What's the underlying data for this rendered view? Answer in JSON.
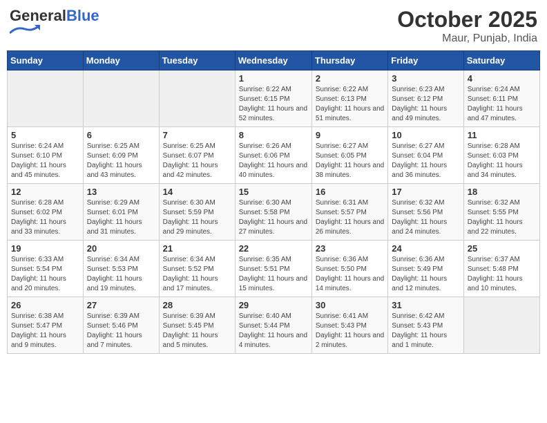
{
  "header": {
    "logo_general": "General",
    "logo_blue": "Blue",
    "title": "October 2025",
    "subtitle": "Maur, Punjab, India"
  },
  "days_of_week": [
    "Sunday",
    "Monday",
    "Tuesday",
    "Wednesday",
    "Thursday",
    "Friday",
    "Saturday"
  ],
  "weeks": [
    [
      {
        "day": "",
        "sunrise": "",
        "sunset": "",
        "daylight": ""
      },
      {
        "day": "",
        "sunrise": "",
        "sunset": "",
        "daylight": ""
      },
      {
        "day": "",
        "sunrise": "",
        "sunset": "",
        "daylight": ""
      },
      {
        "day": "1",
        "sunrise": "6:22 AM",
        "sunset": "6:15 PM",
        "daylight": "11 hours and 52 minutes."
      },
      {
        "day": "2",
        "sunrise": "6:22 AM",
        "sunset": "6:13 PM",
        "daylight": "11 hours and 51 minutes."
      },
      {
        "day": "3",
        "sunrise": "6:23 AM",
        "sunset": "6:12 PM",
        "daylight": "11 hours and 49 minutes."
      },
      {
        "day": "4",
        "sunrise": "6:24 AM",
        "sunset": "6:11 PM",
        "daylight": "11 hours and 47 minutes."
      }
    ],
    [
      {
        "day": "5",
        "sunrise": "6:24 AM",
        "sunset": "6:10 PM",
        "daylight": "11 hours and 45 minutes."
      },
      {
        "day": "6",
        "sunrise": "6:25 AM",
        "sunset": "6:09 PM",
        "daylight": "11 hours and 43 minutes."
      },
      {
        "day": "7",
        "sunrise": "6:25 AM",
        "sunset": "6:07 PM",
        "daylight": "11 hours and 42 minutes."
      },
      {
        "day": "8",
        "sunrise": "6:26 AM",
        "sunset": "6:06 PM",
        "daylight": "11 hours and 40 minutes."
      },
      {
        "day": "9",
        "sunrise": "6:27 AM",
        "sunset": "6:05 PM",
        "daylight": "11 hours and 38 minutes."
      },
      {
        "day": "10",
        "sunrise": "6:27 AM",
        "sunset": "6:04 PM",
        "daylight": "11 hours and 36 minutes."
      },
      {
        "day": "11",
        "sunrise": "6:28 AM",
        "sunset": "6:03 PM",
        "daylight": "11 hours and 34 minutes."
      }
    ],
    [
      {
        "day": "12",
        "sunrise": "6:28 AM",
        "sunset": "6:02 PM",
        "daylight": "11 hours and 33 minutes."
      },
      {
        "day": "13",
        "sunrise": "6:29 AM",
        "sunset": "6:01 PM",
        "daylight": "11 hours and 31 minutes."
      },
      {
        "day": "14",
        "sunrise": "6:30 AM",
        "sunset": "5:59 PM",
        "daylight": "11 hours and 29 minutes."
      },
      {
        "day": "15",
        "sunrise": "6:30 AM",
        "sunset": "5:58 PM",
        "daylight": "11 hours and 27 minutes."
      },
      {
        "day": "16",
        "sunrise": "6:31 AM",
        "sunset": "5:57 PM",
        "daylight": "11 hours and 26 minutes."
      },
      {
        "day": "17",
        "sunrise": "6:32 AM",
        "sunset": "5:56 PM",
        "daylight": "11 hours and 24 minutes."
      },
      {
        "day": "18",
        "sunrise": "6:32 AM",
        "sunset": "5:55 PM",
        "daylight": "11 hours and 22 minutes."
      }
    ],
    [
      {
        "day": "19",
        "sunrise": "6:33 AM",
        "sunset": "5:54 PM",
        "daylight": "11 hours and 20 minutes."
      },
      {
        "day": "20",
        "sunrise": "6:34 AM",
        "sunset": "5:53 PM",
        "daylight": "11 hours and 19 minutes."
      },
      {
        "day": "21",
        "sunrise": "6:34 AM",
        "sunset": "5:52 PM",
        "daylight": "11 hours and 17 minutes."
      },
      {
        "day": "22",
        "sunrise": "6:35 AM",
        "sunset": "5:51 PM",
        "daylight": "11 hours and 15 minutes."
      },
      {
        "day": "23",
        "sunrise": "6:36 AM",
        "sunset": "5:50 PM",
        "daylight": "11 hours and 14 minutes."
      },
      {
        "day": "24",
        "sunrise": "6:36 AM",
        "sunset": "5:49 PM",
        "daylight": "11 hours and 12 minutes."
      },
      {
        "day": "25",
        "sunrise": "6:37 AM",
        "sunset": "5:48 PM",
        "daylight": "11 hours and 10 minutes."
      }
    ],
    [
      {
        "day": "26",
        "sunrise": "6:38 AM",
        "sunset": "5:47 PM",
        "daylight": "11 hours and 9 minutes."
      },
      {
        "day": "27",
        "sunrise": "6:39 AM",
        "sunset": "5:46 PM",
        "daylight": "11 hours and 7 minutes."
      },
      {
        "day": "28",
        "sunrise": "6:39 AM",
        "sunset": "5:45 PM",
        "daylight": "11 hours and 5 minutes."
      },
      {
        "day": "29",
        "sunrise": "6:40 AM",
        "sunset": "5:44 PM",
        "daylight": "11 hours and 4 minutes."
      },
      {
        "day": "30",
        "sunrise": "6:41 AM",
        "sunset": "5:43 PM",
        "daylight": "11 hours and 2 minutes."
      },
      {
        "day": "31",
        "sunrise": "6:42 AM",
        "sunset": "5:43 PM",
        "daylight": "11 hours and 1 minute."
      },
      {
        "day": "",
        "sunrise": "",
        "sunset": "",
        "daylight": ""
      }
    ]
  ]
}
